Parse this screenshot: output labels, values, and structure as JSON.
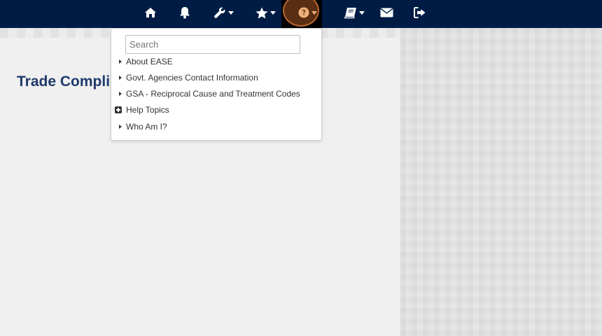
{
  "nav": {
    "icons": [
      "home-icon",
      "bell-icon",
      "wrench-icon",
      "star-icon",
      "question-icon",
      "book-icon",
      "envelope-icon",
      "sign-out-icon"
    ],
    "colors": {
      "bar": "#001c44",
      "icon": "#ffffff",
      "active_ring": "#b8662f"
    }
  },
  "page": {
    "title": "Trade Compli"
  },
  "dropdown": {
    "search_placeholder": "Search",
    "items": [
      {
        "label": "About EASE",
        "type": "arrow"
      },
      {
        "label": "Govt. Agencies Contact Information",
        "type": "arrow"
      },
      {
        "label": "GSA - Reciprocal Cause and Treatment Codes",
        "type": "arrow"
      },
      {
        "label": "Help Topics",
        "type": "expand"
      },
      {
        "label": "Who Am I?",
        "type": "arrow"
      }
    ]
  }
}
